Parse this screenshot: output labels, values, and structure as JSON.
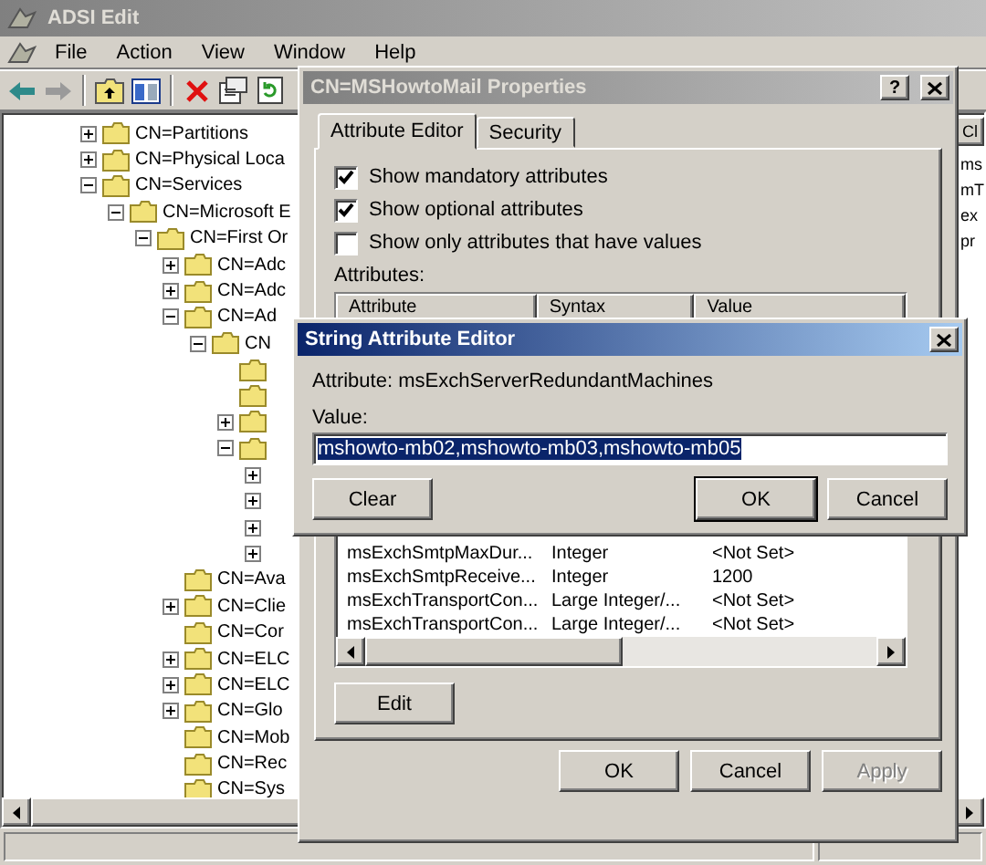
{
  "main_window": {
    "title": "ADSI Edit",
    "active": false
  },
  "menu": [
    "File",
    "Action",
    "View",
    "Window",
    "Help"
  ],
  "toolbar": [
    {
      "kind": "back",
      "disabled": false
    },
    {
      "kind": "forward",
      "disabled": true
    },
    {
      "kind": "up",
      "disabled": false
    },
    {
      "kind": "tree",
      "disabled": false
    },
    {
      "kind": "delete",
      "disabled": false
    },
    {
      "kind": "properties",
      "disabled": false
    },
    {
      "kind": "refresh",
      "disabled": false
    }
  ],
  "tree": [
    {
      "label": "CN=Partitions",
      "expanded": false
    },
    {
      "label": "CN=Physical Loca",
      "expanded": false
    },
    {
      "label": "CN=Services",
      "expanded": true,
      "children": [
        {
          "label": "CN=Microsoft E",
          "expanded": true,
          "children": [
            {
              "label": "CN=First Or",
              "expanded": true,
              "children": [
                {
                  "label": "CN=Adc",
                  "expanded": false
                },
                {
                  "label": "CN=Adc",
                  "expanded": false
                },
                {
                  "label": "CN=Ad",
                  "expanded": true,
                  "children": [
                    {
                      "label": "CN",
                      "expanded": true,
                      "children": [
                        {
                          "folder": true
                        },
                        {
                          "folder": true
                        },
                        {
                          "expanded": false
                        },
                        {
                          "expanded": true,
                          "children": [
                            {
                              "expanded": false,
                              "folder": false
                            },
                            {
                              "expanded": false,
                              "folder": false
                            },
                            {
                              "expanded": false,
                              "folder": false
                            },
                            {
                              "expanded": false,
                              "folder": false
                            }
                          ]
                        }
                      ]
                    }
                  ]
                },
                {
                  "label": "CN=Ava"
                },
                {
                  "label": "CN=Clie",
                  "expanded": false
                },
                {
                  "label": "CN=Cor"
                },
                {
                  "label": "CN=ELC",
                  "expanded": false
                },
                {
                  "label": "CN=ELC",
                  "expanded": false
                },
                {
                  "label": "CN=Glo",
                  "expanded": false
                },
                {
                  "label": "CN=Mob"
                },
                {
                  "label": "CN=Rec"
                },
                {
                  "label": "CN=Sys"
                }
              ]
            }
          ]
        }
      ]
    }
  ],
  "right_pane": {
    "column": "Cl",
    "rows": [
      "ms",
      "mT",
      "ex",
      "pr"
    ]
  },
  "properties_dialog": {
    "title": "CN=MSHowtoMail Properties",
    "active": false,
    "help_button": "?",
    "tabs": [
      {
        "label": "Attribute Editor",
        "selected": true
      },
      {
        "label": "Security",
        "selected": false
      }
    ],
    "options": [
      {
        "label": "Show mandatory attributes",
        "checked": true
      },
      {
        "label": "Show optional attributes",
        "checked": true
      },
      {
        "label": "Show only attributes that have values",
        "checked": false
      }
    ],
    "attributes_label": "Attributes:",
    "attributes_table": {
      "columns": [
        "Attribute",
        "Syntax",
        "Value"
      ],
      "rows": [
        [
          "msExchSmtpMaxDur...",
          "Integer",
          "<Not Set>"
        ],
        [
          "msExchSmtpReceive...",
          "Integer",
          "1200"
        ],
        [
          "msExchTransportCon...",
          "Large Integer/...",
          "<Not Set>"
        ],
        [
          "msExchTransportCon...",
          "Large Integer/...",
          "<Not Set>"
        ]
      ]
    },
    "edit_button": "Edit",
    "buttons": [
      {
        "label": "OK",
        "disabled": false
      },
      {
        "label": "Cancel",
        "disabled": false
      },
      {
        "label": "Apply",
        "disabled": true
      }
    ]
  },
  "string_editor": {
    "title": "String Attribute Editor",
    "active": true,
    "attribute_label": "Attribute:",
    "attribute_name": "msExchServerRedundantMachines",
    "value_label": "Value:",
    "value": "mshowto-mb02,mshowto-mb03,mshowto-mb05",
    "value_selected": true,
    "clear_button": "Clear",
    "buttons": [
      {
        "label": "OK",
        "default": true
      },
      {
        "label": "Cancel",
        "default": false
      }
    ]
  }
}
